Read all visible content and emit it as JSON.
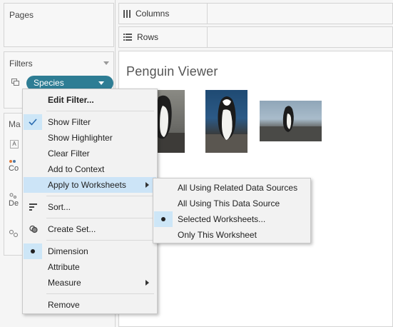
{
  "left_panel": {
    "pages": {
      "title": "Pages"
    },
    "filters": {
      "title": "Filters",
      "pill_label": "Species"
    },
    "marks": {
      "title_fragment": "Ma",
      "frag_color": "Co",
      "frag_detail": "De"
    }
  },
  "shelves": {
    "columns_label": "Columns",
    "rows_label": "Rows"
  },
  "view": {
    "title": "Penguin Viewer"
  },
  "context_menu": {
    "edit_filter": "Edit Filter...",
    "show_filter": "Show Filter",
    "show_highlighter": "Show Highlighter",
    "clear_filter": "Clear Filter",
    "add_to_context": "Add to Context",
    "apply_to_worksheets": "Apply to Worksheets",
    "sort": "Sort...",
    "create_set": "Create Set...",
    "dimension": "Dimension",
    "attribute": "Attribute",
    "measure": "Measure",
    "remove": "Remove"
  },
  "submenu": {
    "all_related": "All Using Related Data Sources",
    "all_this_source": "All Using This Data Source",
    "selected_worksheets": "Selected Worksheets...",
    "only_this": "Only This Worksheet"
  },
  "colors": {
    "pill": "#2e7d94",
    "highlight": "#cce4f7",
    "menu_bg": "#f2f2f2"
  }
}
